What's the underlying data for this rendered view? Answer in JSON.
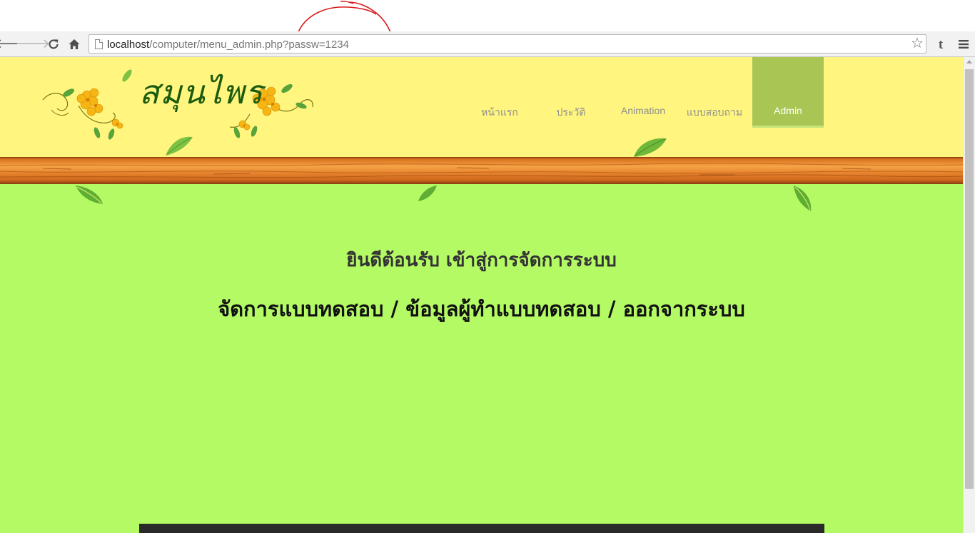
{
  "browser": {
    "url_host": "localhost",
    "url_path": "/computer/menu_admin.php?passw=1234",
    "icons": {
      "back": "back-arrow-icon",
      "forward": "forward-arrow-icon",
      "reload": "reload-icon",
      "home": "home-icon",
      "page": "page-icon",
      "bookmark": "star-icon",
      "extension": "tumblr-icon",
      "menu": "hamburger-menu-icon"
    }
  },
  "site": {
    "logo_text": "สมุนไพร",
    "nav": [
      {
        "label": "หน้าแรก",
        "active": false
      },
      {
        "label": "ประวัติ",
        "active": false
      },
      {
        "label": "Animation",
        "active": false
      },
      {
        "label": "แบบสอบถาม",
        "active": false
      },
      {
        "label": "Admin",
        "active": true
      }
    ],
    "colors": {
      "header_bg": "#fff57f",
      "body_bg": "#b4fa65",
      "nav_active_bg": "#a9c654",
      "annotation": "#d81b1b"
    }
  },
  "main": {
    "welcome": "ยินดีต้อนรับ เข้าสู่การจัดการระบบ",
    "links": [
      {
        "label": "จัดการแบบทดสอบ"
      },
      {
        "label": "ข้อมูลผู้ทำแบบทดสอบ"
      },
      {
        "label": "ออกจากระบบ"
      }
    ],
    "separator": " / "
  }
}
